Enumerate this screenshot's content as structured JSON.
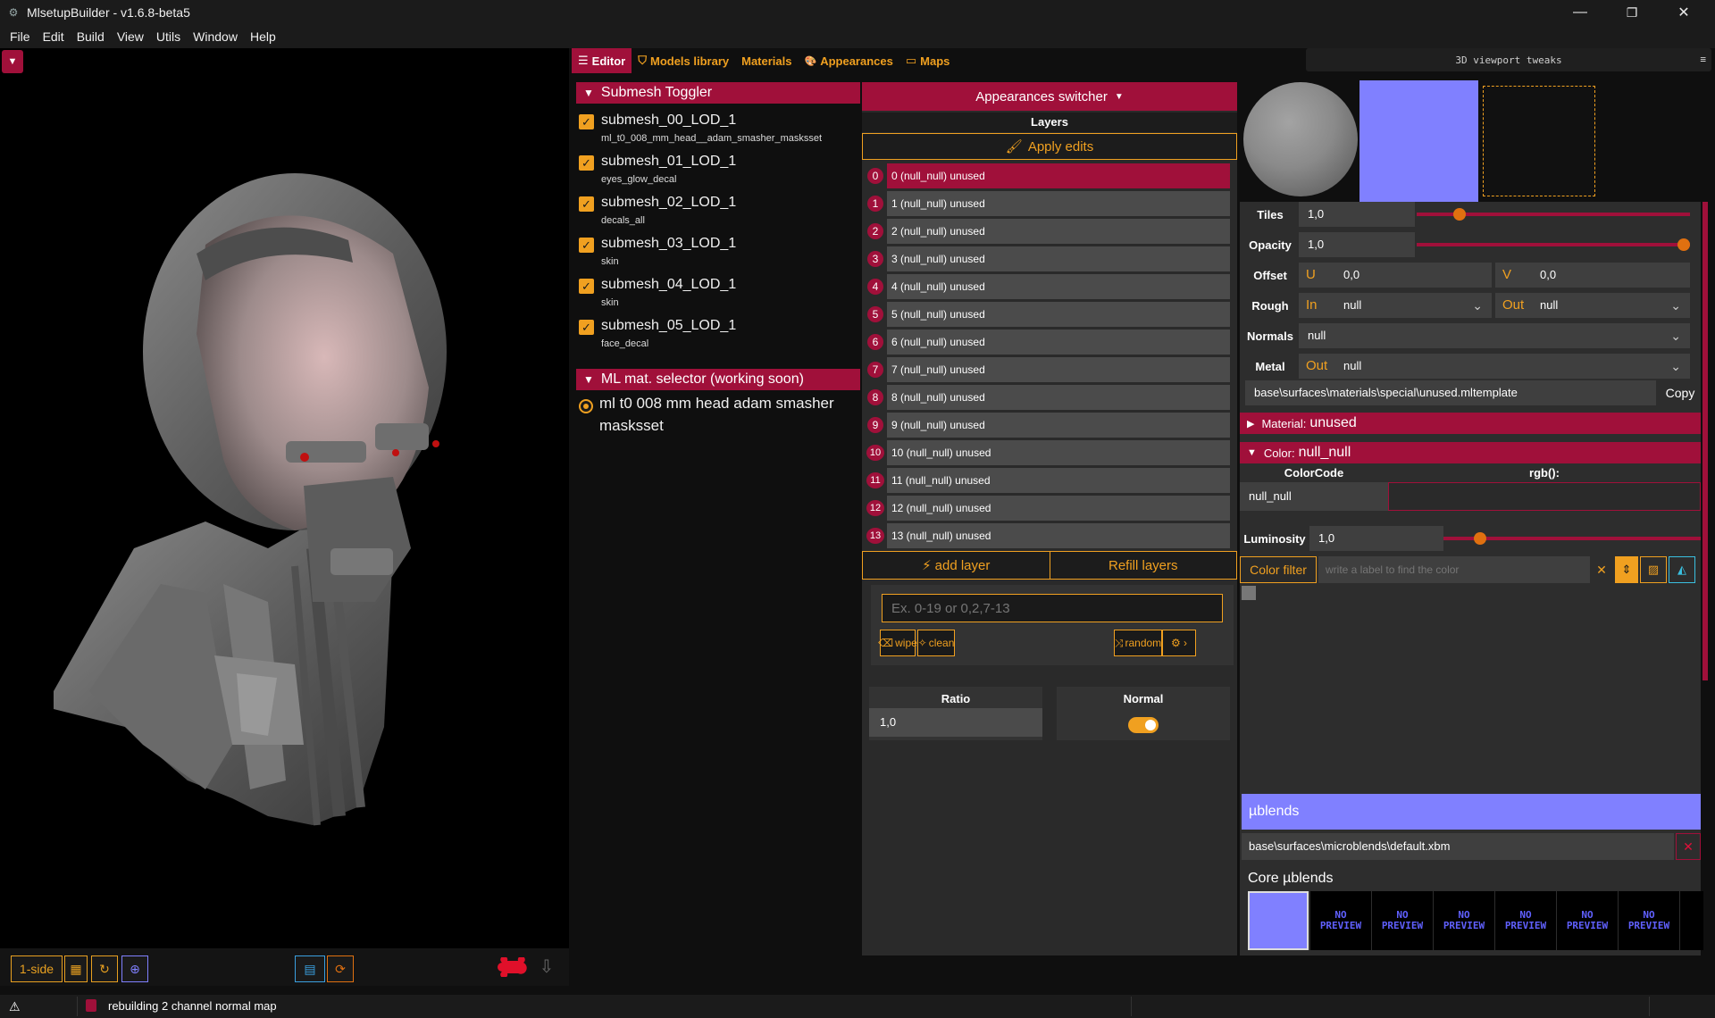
{
  "window": {
    "title": "MlsetupBuilder - v1.6.8-beta5",
    "minimize": "—",
    "restore": "❐",
    "close": "✕"
  },
  "menu": [
    "File",
    "Edit",
    "Build",
    "View",
    "Utils",
    "Window",
    "Help"
  ],
  "tabs": [
    {
      "label": "Editor",
      "icon": "☰"
    },
    {
      "label": "Models library",
      "icon": "⛉"
    },
    {
      "label": "Materials",
      "icon": ""
    },
    {
      "label": "Appearances",
      "icon": "🎨"
    },
    {
      "label": "Maps",
      "icon": "▭"
    }
  ],
  "submesh_toggler": {
    "title": "Submesh Toggler",
    "items": [
      {
        "name": "submesh_00_LOD_1",
        "sub": "ml_t0_008_mm_head__adam_smasher_masksset"
      },
      {
        "name": "submesh_01_LOD_1",
        "sub": "eyes_glow_decal"
      },
      {
        "name": "submesh_02_LOD_1",
        "sub": "decals_all"
      },
      {
        "name": "submesh_03_LOD_1",
        "sub": "skin"
      },
      {
        "name": "submesh_04_LOD_1",
        "sub": "skin"
      },
      {
        "name": "submesh_05_LOD_1",
        "sub": "face_decal"
      }
    ]
  },
  "ml_selector": {
    "title": "ML mat. selector (working soon)",
    "option": "ml t0 008 mm head adam smasher masksset"
  },
  "layers_panel": {
    "switcher": "Appearances switcher",
    "layers_title": "Layers",
    "apply": "Apply edits",
    "layers": [
      {
        "num": "0",
        "label": "0 (null_null) unused"
      },
      {
        "num": "1",
        "label": "1 (null_null) unused"
      },
      {
        "num": "2",
        "label": "2 (null_null) unused"
      },
      {
        "num": "3",
        "label": "3 (null_null) unused"
      },
      {
        "num": "4",
        "label": "4 (null_null) unused"
      },
      {
        "num": "5",
        "label": "5 (null_null) unused"
      },
      {
        "num": "6",
        "label": "6 (null_null) unused"
      },
      {
        "num": "7",
        "label": "7 (null_null) unused"
      },
      {
        "num": "8",
        "label": "8 (null_null) unused"
      },
      {
        "num": "9",
        "label": "9 (null_null) unused"
      },
      {
        "num": "10",
        "label": "10 (null_null) unused"
      },
      {
        "num": "11",
        "label": "11 (null_null) unused"
      },
      {
        "num": "12",
        "label": "12 (null_null) unused"
      },
      {
        "num": "13",
        "label": "13 (null_null) unused"
      }
    ],
    "add_layer": "add layer",
    "refill_layers": "Refill layers",
    "range_placeholder": "Ex. 0-19 or 0,2,7-13",
    "wipe": "wipe",
    "clean": "clean",
    "random": "random",
    "ratio_label": "Ratio",
    "ratio_value": "1,0",
    "normal_label": "Normal",
    "normal_on": true
  },
  "viewport_toolbar": {
    "side": "1-side"
  },
  "right_panel": {
    "tweaks": "3D viewport tweaks",
    "tweaks_icon": "≡",
    "tiles_label": "Tiles",
    "tiles_value": "1,0",
    "opacity_label": "Opacity",
    "opacity_value": "1,0",
    "offset_label": "Offset",
    "u_label": "U",
    "u_value": "0,0",
    "v_label": "V",
    "v_value": "0,0",
    "rough_label": "Rough",
    "in_label": "In",
    "rough_in": "null",
    "out_label": "Out",
    "rough_out": "null",
    "normals_label": "Normals",
    "normals_value": "null",
    "metal_label": "Metal",
    "metal_out_label": "Out",
    "metal_value": "null",
    "path": "base\\surfaces\\materials\\special\\unused.mltemplate",
    "copy": "Copy",
    "material_pre": "Material:",
    "material_val": "unused",
    "color_pre": "Color:",
    "color_val": "null_null",
    "colorcode_label": "ColorCode",
    "rgb_label": "rgb():",
    "colorcode_value": "null_null",
    "luminosity_label": "Luminosity",
    "luminosity_value": "1,0",
    "color_filter": "Color filter",
    "filter_placeholder": "write a label to find the color",
    "ublends_title": "µblends",
    "ublends_path": "base\\surfaces\\microblends\\default.xbm",
    "core_ublends": "Core µblends",
    "no_preview_1": "NO",
    "no_preview_2": "PREVIEW"
  },
  "status": {
    "warning_icon": "⚠",
    "message": "rebuilding 2 channel normal map"
  },
  "colors": {
    "accent": "#a0103a",
    "orange": "#f0a020",
    "normal_blue": "#8080ff"
  }
}
